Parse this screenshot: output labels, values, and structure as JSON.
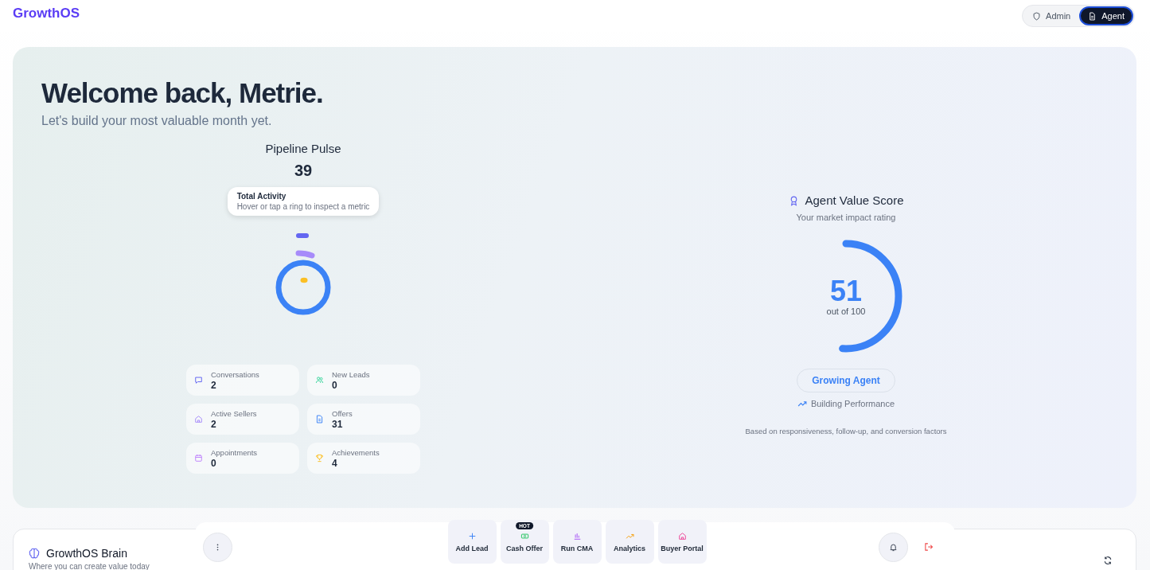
{
  "header": {
    "logo": "GrowthOS",
    "roles": [
      {
        "label": "Admin",
        "kind": "shield",
        "selected": false
      },
      {
        "label": "Agent",
        "kind": "document",
        "selected": true
      }
    ]
  },
  "hero": {
    "title": "Welcome back, Metrie.",
    "subtitle": "Let's build your most valuable month yet.",
    "pipeline": {
      "title": "Pipeline Pulse",
      "total": "39",
      "tooltip": {
        "title": "Total Activity",
        "text": "Hover or tap a ring to inspect a metric"
      },
      "stats": [
        {
          "label": "Conversations",
          "value": "2",
          "kind": "chat"
        },
        {
          "label": "New Leads",
          "value": "0",
          "kind": "users"
        },
        {
          "label": "Active Sellers",
          "value": "2",
          "kind": "home"
        },
        {
          "label": "Offers",
          "value": "31",
          "kind": "file"
        },
        {
          "label": "Appointments",
          "value": "0",
          "kind": "calendar"
        },
        {
          "label": "Achievements",
          "value": "4",
          "kind": "trophy"
        }
      ]
    },
    "score": {
      "title": "Agent Value Score",
      "subtitle": "Your market impact rating",
      "value": "51",
      "out_of": "out of 100",
      "level": 0.51,
      "badge": "Growing Agent",
      "trend": "Building Performance",
      "footnote": "Based on responsiveness, follow-up, and conversion factors"
    }
  },
  "brain": {
    "title": "GrowthOS Brain",
    "subtitle": "Where you can create value today"
  },
  "dock": {
    "actions": [
      {
        "label": "Add Lead",
        "kind": "plus"
      },
      {
        "label": "Cash Offer",
        "kind": "cash",
        "badge": "HOT"
      },
      {
        "label": "Run CMA",
        "kind": "bars"
      },
      {
        "label": "Analytics",
        "kind": "trend"
      },
      {
        "label": "Buyer Portal",
        "kind": "home"
      }
    ]
  }
}
